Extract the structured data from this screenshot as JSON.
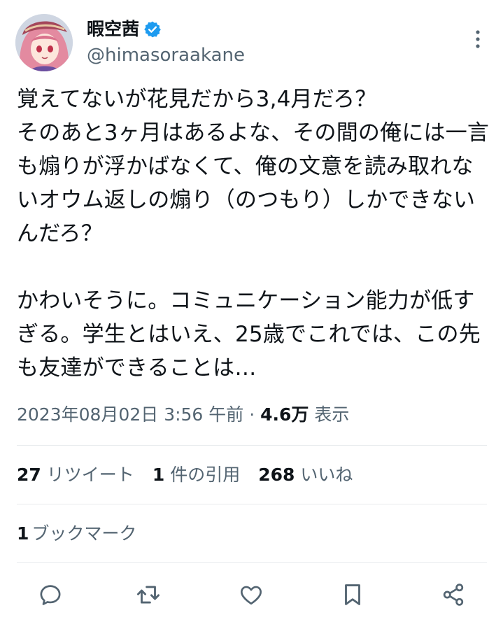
{
  "author": {
    "display_name": "暇空茜",
    "handle": "@himasoraakane",
    "verified_icon": "verified-badge-icon",
    "avatar": "anime-character-avatar"
  },
  "tweet": {
    "text": "覚えてないが花見だから3,4月だろ？\nそのあと3ヶ月はあるよな、その間の俺には一言も煽りが浮かばなくて、俺の文意を読み取れないオウム返しの煽り（のつもり）しかできないんだろ？\n\nかわいそうに。コミュニケーション能力が低すぎる。学生とはいえ、25歳でこれでは、この先も友達ができることは…"
  },
  "meta": {
    "timestamp": "2023年08月02日 3:56 午前",
    "separator": "·",
    "views_count": "4.6万",
    "views_label": "表示"
  },
  "stats": {
    "retweets_count": "27",
    "retweets_label": "リツイート",
    "quotes_count": "1",
    "quotes_label": "件の引用",
    "likes_count": "268",
    "likes_label": "いいね"
  },
  "bookmarks": {
    "count": "1",
    "label": "ブックマーク"
  },
  "actions": [
    "reply-icon",
    "retweet-icon",
    "like-icon",
    "bookmark-icon",
    "share-icon"
  ],
  "colors": {
    "text": "#0f1419",
    "secondary": "#536471",
    "divider": "#e7eaed",
    "verified": "#1d9bf0"
  }
}
